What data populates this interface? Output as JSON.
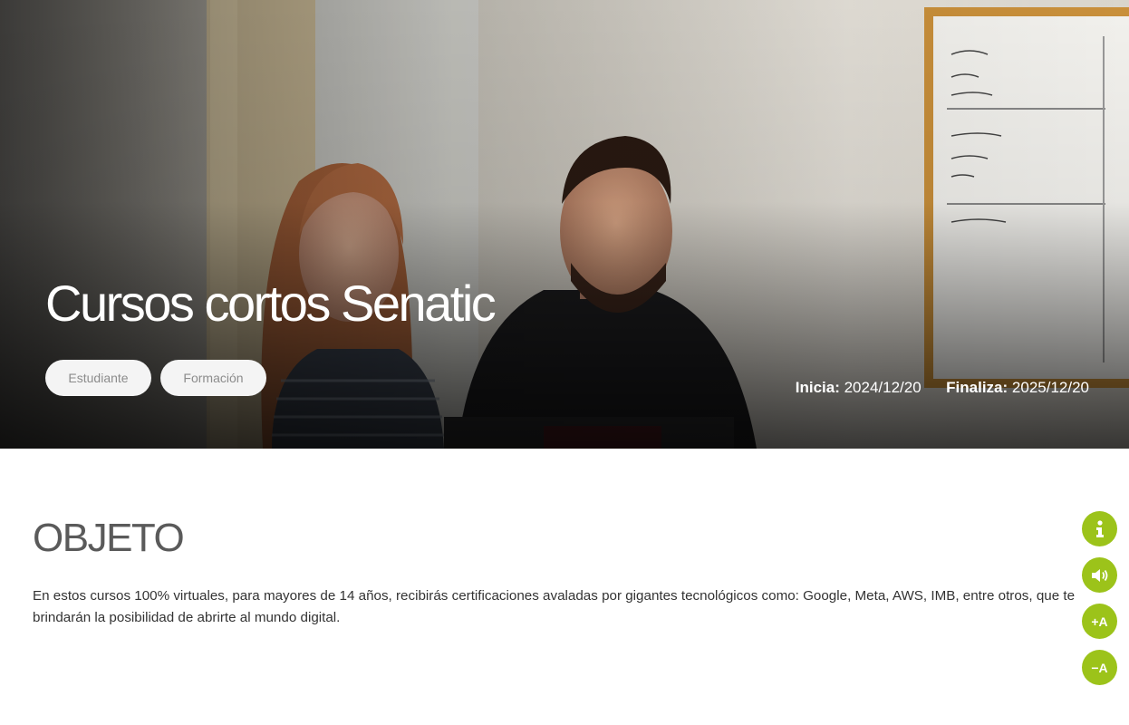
{
  "hero": {
    "title": "Cursos cortos Senatic",
    "tags": [
      "Estudiante",
      "Formación"
    ],
    "start_label": "Inicia:",
    "start_date": "2024/12/20",
    "end_label": "Finaliza:",
    "end_date": "2025/12/20"
  },
  "section": {
    "title": "OBJETO",
    "text": "En estos cursos 100% virtuales, para mayores de 14 años, recibirás certificaciones avaladas por gigantes tecnológicos como: Google, Meta, AWS, IMB, entre otros, que te brindarán la posibilidad de abrirte al mundo digital."
  },
  "accessibility": {
    "info_icon": "info-icon",
    "audio_icon": "speaker-icon",
    "increase_label": "+A",
    "decrease_label": "−A",
    "accent_color": "#9cc31a"
  }
}
